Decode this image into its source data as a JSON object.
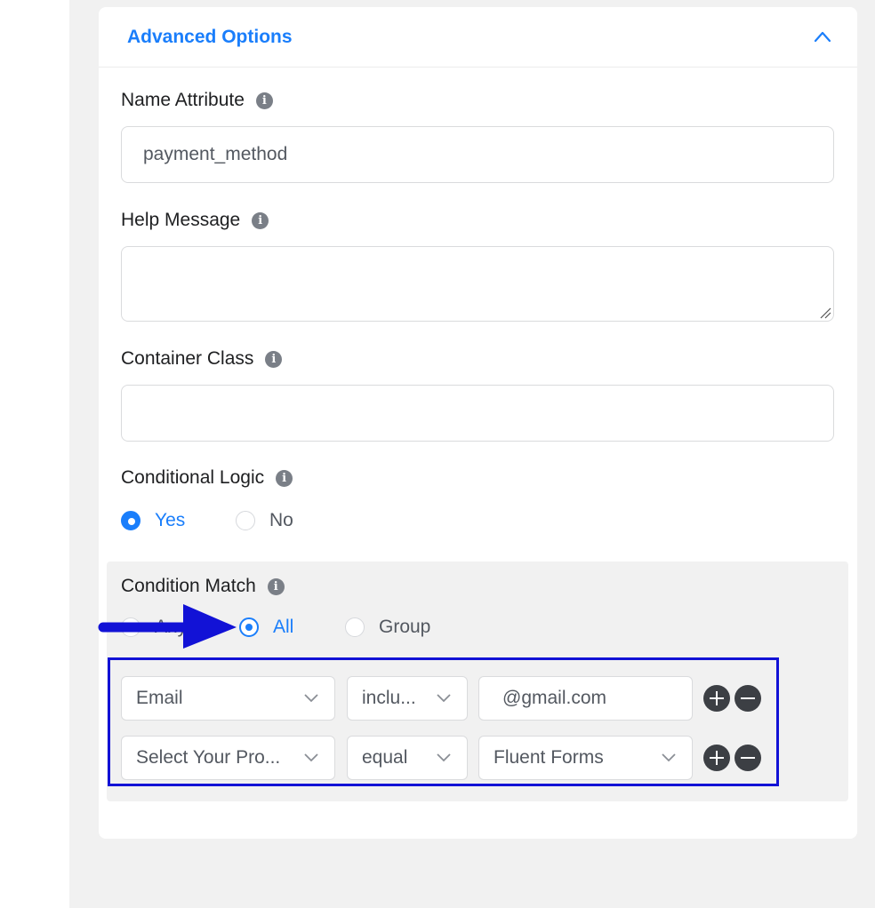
{
  "panel": {
    "title": "Advanced Options",
    "collapse_icon": "chevron-up-icon"
  },
  "fields": {
    "name_attribute": {
      "label": "Name Attribute",
      "value": "payment_method"
    },
    "help_message": {
      "label": "Help Message",
      "value": ""
    },
    "container_class": {
      "label": "Container Class",
      "value": ""
    }
  },
  "conditional_logic": {
    "label": "Conditional Logic",
    "options": [
      "Yes",
      "No"
    ],
    "selected": "Yes"
  },
  "condition_match": {
    "label": "Condition Match",
    "options": [
      "Any",
      "All",
      "Group"
    ],
    "selected": "All"
  },
  "rules": [
    {
      "field": "Email",
      "operator": "inclu...",
      "value": "@gmail.com"
    },
    {
      "field": "Select Your Pro...",
      "operator": "equal",
      "value": "Fluent Forms"
    }
  ],
  "colors": {
    "accent": "#1a7efb",
    "annotation": "#1212d6",
    "text": "#1e1f21",
    "muted": "#535860"
  }
}
